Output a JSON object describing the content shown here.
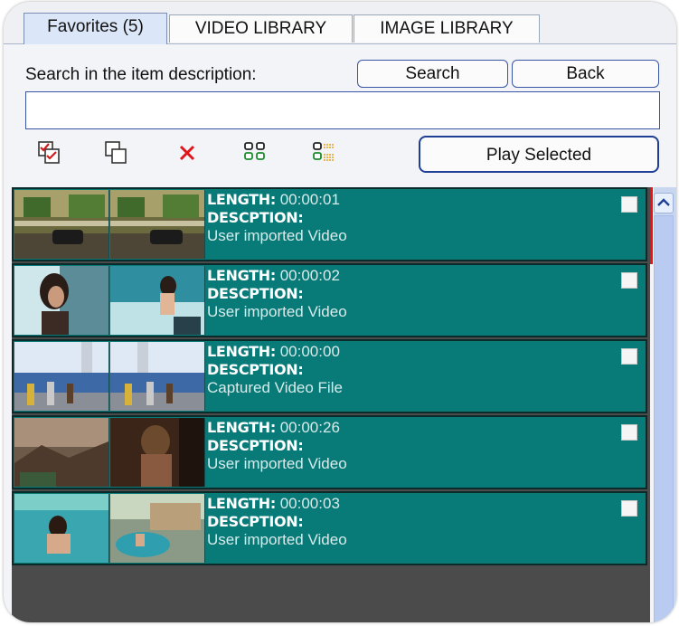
{
  "tabs": [
    {
      "label": "Favorites (5)"
    },
    {
      "label": "VIDEO LIBRARY"
    },
    {
      "label": "IMAGE LIBRARY"
    }
  ],
  "search": {
    "label": "Search in the item description:",
    "button": "Search",
    "back": "Back",
    "value": ""
  },
  "toolbar": {
    "icons": [
      "select-all-icon",
      "deselect-all-icon",
      "delete-icon",
      "view-grid-icon",
      "view-list-icon"
    ],
    "play_label": "Play Selected",
    "accent": "#1f3f96"
  },
  "list": {
    "length_key": "LENGTH:",
    "desc_key": "DESCPTION:",
    "items": [
      {
        "length": "00:00:01",
        "description": "User imported Video",
        "checked": false
      },
      {
        "length": "00:00:02",
        "description": "User imported Video",
        "checked": false
      },
      {
        "length": "00:00:00",
        "description": "Captured Video File",
        "checked": false
      },
      {
        "length": "00:00:26",
        "description": "User imported Video",
        "checked": false
      },
      {
        "length": "00:00:03",
        "description": "User imported Video",
        "checked": false
      }
    ],
    "row_color": "#087b78",
    "selected_marker_color": "#e8121a"
  }
}
